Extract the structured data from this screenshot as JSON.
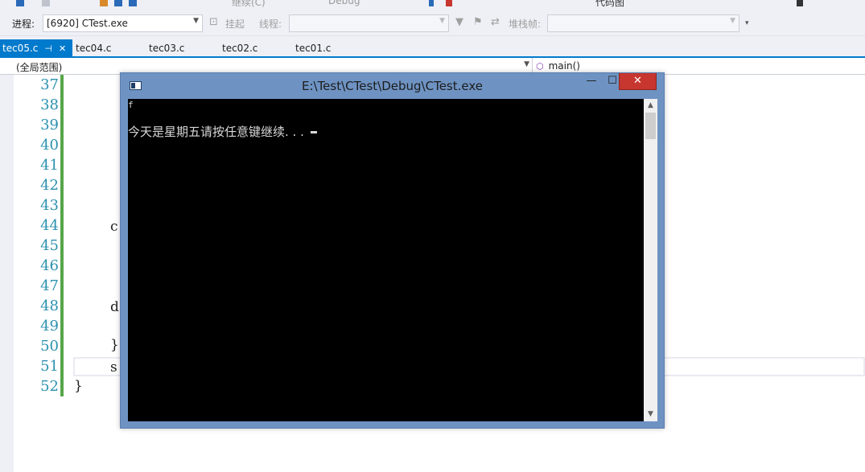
{
  "toolbar": {
    "continue_label": "继续(C)",
    "config_label": "Debug",
    "code_map_label": "代码图"
  },
  "debug_bar": {
    "process_label": "进程:",
    "process_value": "[6920] CTest.exe",
    "suspend_label": "挂起",
    "thread_label": "线程:",
    "stackframe_label": "堆栈帧:"
  },
  "tabs": [
    {
      "label": "tec05.c",
      "active": true
    },
    {
      "label": "tec04.c",
      "active": false
    },
    {
      "label": "tec03.c",
      "active": false
    },
    {
      "label": "tec02.c",
      "active": false
    },
    {
      "label": "tec01.c",
      "active": false
    }
  ],
  "navbar": {
    "scope": "(全局范围)",
    "function": "main()"
  },
  "editor": {
    "line_numbers": [
      "37",
      "38",
      "39",
      "40",
      "41",
      "42",
      "43",
      "44",
      "45",
      "46",
      "47",
      "48",
      "49",
      "50",
      "51",
      "52"
    ],
    "visible_code": {
      "l44": "c",
      "l48": "d",
      "l50": "}",
      "l51": "s",
      "l52": "}"
    }
  },
  "console": {
    "title": "E:\\Test\\CTest\\Debug\\CTest.exe",
    "min_glyph": "—",
    "max_glyph": "☐",
    "close_glyph": "✕",
    "output_line1": "f",
    "output_line2": "今天是星期五请按任意键继续. . ."
  },
  "icons": {
    "console_sysicon": "console-window-icon",
    "scroll_up": "▲",
    "scroll_down": "▼"
  }
}
